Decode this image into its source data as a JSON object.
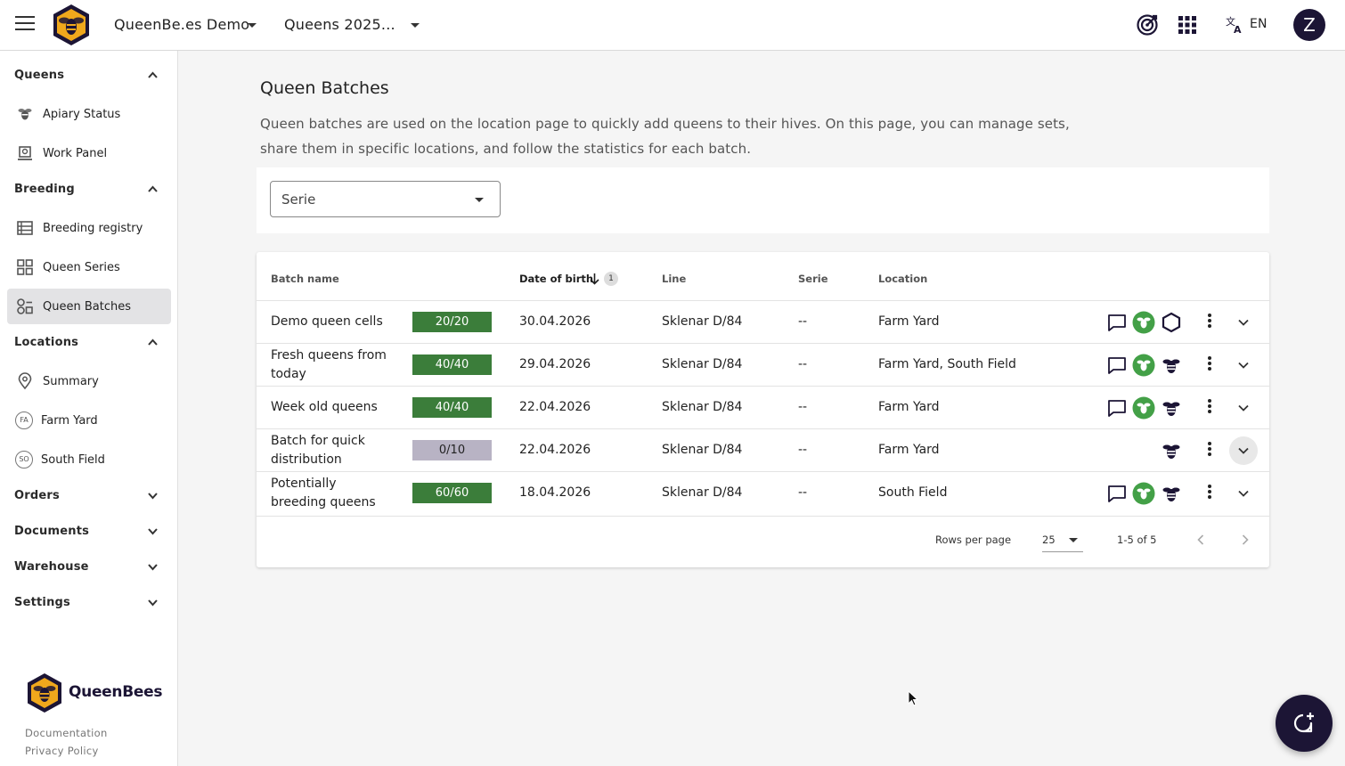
{
  "topbar": {
    "org_label": "QueenBe.es Demo",
    "season_label": "Queens 2025...",
    "lang_label": "EN",
    "avatar_initial": "Z"
  },
  "sidebar": {
    "sections": {
      "queens": "Queens",
      "breeding": "Breeding",
      "locations": "Locations",
      "orders": "Orders",
      "documents": "Documents",
      "warehouse": "Warehouse",
      "settings": "Settings"
    },
    "items": {
      "apiary_status": "Apiary Status",
      "work_panel": "Work Panel",
      "breeding_registry": "Breeding registry",
      "queen_series": "Queen Series",
      "queen_batches": "Queen Batches",
      "summary": "Summary",
      "farm_yard": "Farm Yard",
      "farm_yard_abbr": "FA",
      "south_field": "South Field",
      "south_field_abbr": "SO"
    },
    "brand": "QueenBees",
    "documentation": "Documentation",
    "privacy": "Privacy Policy"
  },
  "page": {
    "title": "Queen Batches",
    "description": "Queen batches are used on the location page to quickly add queens to their hives. On this page, you can manage sets, share them in specific locations, and follow the statistics for each batch."
  },
  "filter": {
    "serie_value": "Serie"
  },
  "table": {
    "headers": {
      "batch_name": "Batch name",
      "date_of_birth": "Date of birth",
      "sort_priority": "1",
      "line": "Line",
      "serie": "Serie",
      "location": "Location"
    },
    "rows": [
      {
        "name": "Demo queen cells",
        "progress": "20/20",
        "progress_fraction": 1.0,
        "dob": "30.04.2026",
        "line": "Sklenar D/84",
        "serie": "--",
        "location": "Farm Yard"
      },
      {
        "name": "Fresh queens from today",
        "progress": "40/40",
        "progress_fraction": 1.0,
        "dob": "29.04.2026",
        "line": "Sklenar D/84",
        "serie": "--",
        "location": "Farm Yard, South Field"
      },
      {
        "name": "Week old queens",
        "progress": "40/40",
        "progress_fraction": 1.0,
        "dob": "22.04.2026",
        "line": "Sklenar D/84",
        "serie": "--",
        "location": "Farm Yard"
      },
      {
        "name": "Batch for quick distribution",
        "progress": "0/10",
        "progress_fraction": 0.0,
        "dob": "22.04.2026",
        "line": "Sklenar D/84",
        "serie": "--",
        "location": "Farm Yard"
      },
      {
        "name": "Potentially breeding queens",
        "progress": "60/60",
        "progress_fraction": 1.0,
        "dob": "18.04.2026",
        "line": "Sklenar D/84",
        "serie": "--",
        "location": "South Field"
      }
    ],
    "footer": {
      "rows_per_page_label": "Rows per page",
      "rows_per_page_value": "25",
      "range": "1-5 of 5"
    }
  },
  "colors": {
    "progress_full": "#3b7d3a",
    "progress_empty": "#b8b3c4",
    "brand_dark": "#1c1535",
    "brand_gold": "#f0a81c",
    "icon_green": "#43a047"
  }
}
